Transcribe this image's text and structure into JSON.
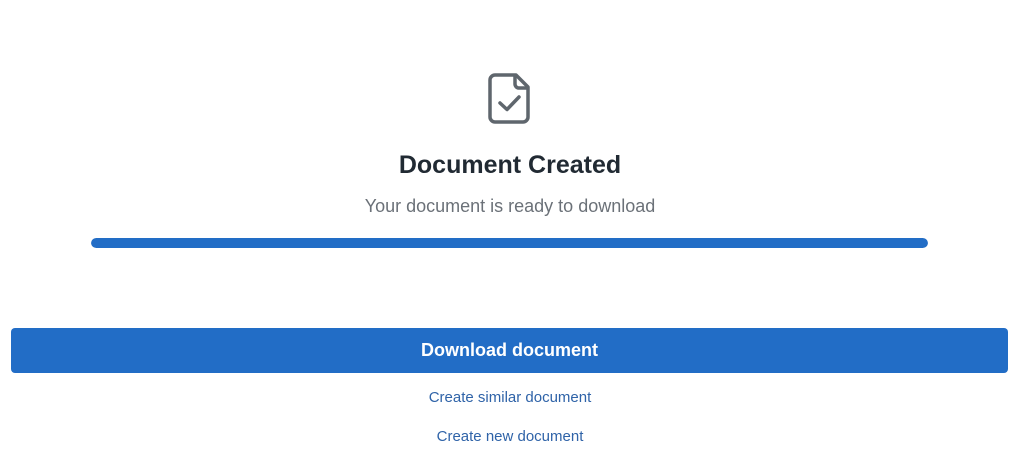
{
  "status": {
    "icon": "document-check-icon",
    "title": "Document Created",
    "subtitle": "Your document is ready to download",
    "progress_percent": 100
  },
  "actions": {
    "download_label": "Download document",
    "create_similar_label": "Create similar document",
    "create_new_label": "Create new document"
  },
  "colors": {
    "accent": "#226dc6",
    "title_text": "#212a33",
    "subtitle_text": "#6b7178",
    "link_text": "#2f63a8",
    "icon_stroke": "#5f666d"
  }
}
